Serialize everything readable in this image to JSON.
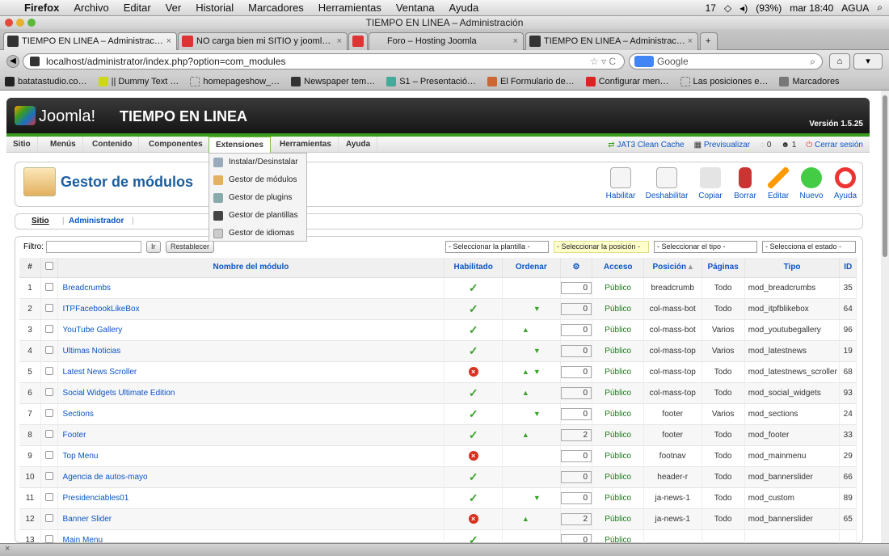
{
  "menubar": {
    "apple": "",
    "app": "Firefox",
    "items": [
      "Archivo",
      "Editar",
      "Ver",
      "Historial",
      "Marcadores",
      "Herramientas",
      "Ventana",
      "Ayuda"
    ],
    "status": {
      "ai": "17",
      "battery": "(93%)",
      "clock": "mar 18:40",
      "user": "AGUA"
    }
  },
  "window": {
    "title": "TIEMPO EN LINEA – Administración"
  },
  "tabs": [
    {
      "label": "TIEMPO EN LINEA – Administrac…",
      "color": "#333",
      "active": true
    },
    {
      "label": "NO carga bien mi SITIO y jooml…",
      "color": "#d33",
      "active": false
    },
    {
      "label": "",
      "color": "#d33",
      "active": false
    },
    {
      "label": "Foro – Hosting Joomla",
      "color": "#888",
      "active": false
    },
    {
      "label": "TIEMPO EN LINEA – Administrac…",
      "color": "#333",
      "active": false
    }
  ],
  "nav": {
    "url": "localhost/administrator/index.php?option=com_modules",
    "search_placeholder": "Google"
  },
  "bookmarks": [
    "batatastudio.co…",
    "|| Dummy Text …",
    "homepageshow_…",
    "Newspaper tem…",
    "S1 – Presentació…",
    "El Formulario de…",
    "Configurar men…",
    "Las posiciones e…",
    "Marcadores"
  ],
  "joomla": {
    "logo": "Joomla!",
    "site": "TIEMPO EN LINEA",
    "version": "Versión 1.5.25",
    "menu": [
      "Sitio",
      "Menús",
      "Contenido",
      "Componentes",
      "Extensiones",
      "Herramientas",
      "Ayuda"
    ],
    "right": {
      "cache": "JAT3 Clean Cache",
      "preview": "Previsualizar",
      "count1": "0",
      "count2": "1",
      "logout": "Cerrar sesión"
    },
    "dropdown": [
      "Instalar/Desinstalar",
      "Gestor de módulos",
      "Gestor de plugins",
      "Gestor de plantillas",
      "Gestor de idiomas"
    ],
    "page_title": "Gestor de módulos",
    "toolbar": [
      "Habilitar",
      "Deshabilitar",
      "Copiar",
      "Borrar",
      "Editar",
      "Nuevo",
      "Ayuda"
    ],
    "subnav": [
      "Sitio",
      "Administrador"
    ],
    "filter": {
      "label": "Filtro:",
      "go": "Ir",
      "reset": "Restablecer",
      "sel_template": "- Seleccionar la plantilla -",
      "sel_position": "- Seleccionar la posición -",
      "sel_type": "- Seleccionar el tipo -",
      "sel_state": "- Selecciona el estado -"
    },
    "columns": [
      "#",
      "",
      "Nombre del módulo",
      "Habilitado",
      "Ordenar",
      "",
      "Acceso",
      "Posición",
      "Páginas",
      "Tipo",
      "ID"
    ],
    "rows": [
      {
        "n": "1",
        "name": "Breadcrumbs",
        "on": true,
        "up": false,
        "down": false,
        "order": "0",
        "access": "Público",
        "pos": "breadcrumb",
        "pages": "Todo",
        "type": "mod_breadcrumbs",
        "id": "35"
      },
      {
        "n": "2",
        "name": "ITPFacebookLikeBox",
        "on": true,
        "up": false,
        "down": true,
        "order": "0",
        "access": "Público",
        "pos": "col-mass-bot",
        "pages": "Todo",
        "type": "mod_itpfblikebox",
        "id": "64"
      },
      {
        "n": "3",
        "name": "YouTube Gallery",
        "on": true,
        "up": true,
        "down": false,
        "order": "0",
        "access": "Público",
        "pos": "col-mass-bot",
        "pages": "Varios",
        "type": "mod_youtubegallery",
        "id": "96"
      },
      {
        "n": "4",
        "name": "Ultimas Noticias",
        "on": true,
        "up": false,
        "down": true,
        "order": "0",
        "access": "Público",
        "pos": "col-mass-top",
        "pages": "Varios",
        "type": "mod_latestnews",
        "id": "19"
      },
      {
        "n": "5",
        "name": "Latest News Scroller",
        "on": false,
        "up": true,
        "down": true,
        "order": "0",
        "access": "Público",
        "pos": "col-mass-top",
        "pages": "Todo",
        "type": "mod_latestnews_scroller",
        "id": "68"
      },
      {
        "n": "6",
        "name": "Social Widgets Ultimate Edition",
        "on": true,
        "up": true,
        "down": false,
        "order": "0",
        "access": "Público",
        "pos": "col-mass-top",
        "pages": "Todo",
        "type": "mod_social_widgets",
        "id": "93"
      },
      {
        "n": "7",
        "name": "Sections",
        "on": true,
        "up": false,
        "down": true,
        "order": "0",
        "access": "Público",
        "pos": "footer",
        "pages": "Varios",
        "type": "mod_sections",
        "id": "24"
      },
      {
        "n": "8",
        "name": "Footer",
        "on": true,
        "up": true,
        "down": false,
        "order": "2",
        "access": "Público",
        "pos": "footer",
        "pages": "Todo",
        "type": "mod_footer",
        "id": "33"
      },
      {
        "n": "9",
        "name": "Top Menu",
        "on": false,
        "up": false,
        "down": false,
        "order": "0",
        "access": "Público",
        "pos": "footnav",
        "pages": "Todo",
        "type": "mod_mainmenu",
        "id": "29"
      },
      {
        "n": "10",
        "name": "Agencia de autos-mayo",
        "on": true,
        "up": false,
        "down": false,
        "order": "0",
        "access": "Público",
        "pos": "header-r",
        "pages": "Todo",
        "type": "mod_bannerslider",
        "id": "66"
      },
      {
        "n": "11",
        "name": "Presidenciables01",
        "on": true,
        "up": false,
        "down": true,
        "order": "0",
        "access": "Público",
        "pos": "ja-news-1",
        "pages": "Todo",
        "type": "mod_custom",
        "id": "89"
      },
      {
        "n": "12",
        "name": "Banner Slider",
        "on": false,
        "up": true,
        "down": false,
        "order": "2",
        "access": "Público",
        "pos": "ja-news-1",
        "pages": "Todo",
        "type": "mod_bannerslider",
        "id": "65"
      },
      {
        "n": "13",
        "name": "Main Menu",
        "on": true,
        "up": false,
        "down": false,
        "order": "0",
        "access": "Público",
        "pos": "",
        "pages": "",
        "type": "",
        "id": ""
      }
    ]
  }
}
